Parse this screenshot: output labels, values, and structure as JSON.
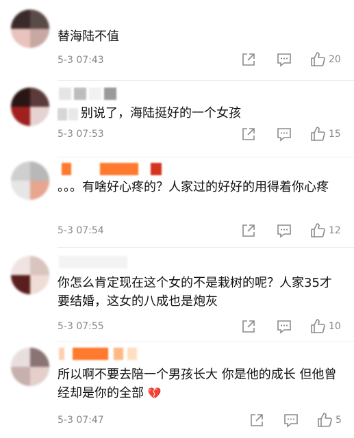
{
  "comments": [
    {
      "text": "替海陆不值",
      "time": "5-3 07:43",
      "likes": "20"
    },
    {
      "text": "别说了，海陆挺好的一个女孩",
      "time": "5-3 07:53",
      "likes": "15"
    },
    {
      "text": "。。。有啥好心疼的？人家过的好好的用得着你心疼",
      "time": "5-3 07:54",
      "likes": "12"
    },
    {
      "text": "你怎么肯定现在这个女的不是栽树的呢？人家35才要结婚，这女的八成也是炮灰",
      "time": "5-3 07:55",
      "likes": "10"
    },
    {
      "text": "所以啊不要去陪一个男孩长大 你是他的成长 但他曾经却是你的全部",
      "emoji": "💔",
      "time": "5-3 07:47",
      "likes": "5"
    }
  ],
  "icons": {
    "share": "share-icon",
    "reply": "comment-icon",
    "like": "thumbs-up-icon"
  },
  "colors": {
    "meta": "#888888",
    "text": "#111111",
    "redacted_orange": "#ff7a2e"
  }
}
